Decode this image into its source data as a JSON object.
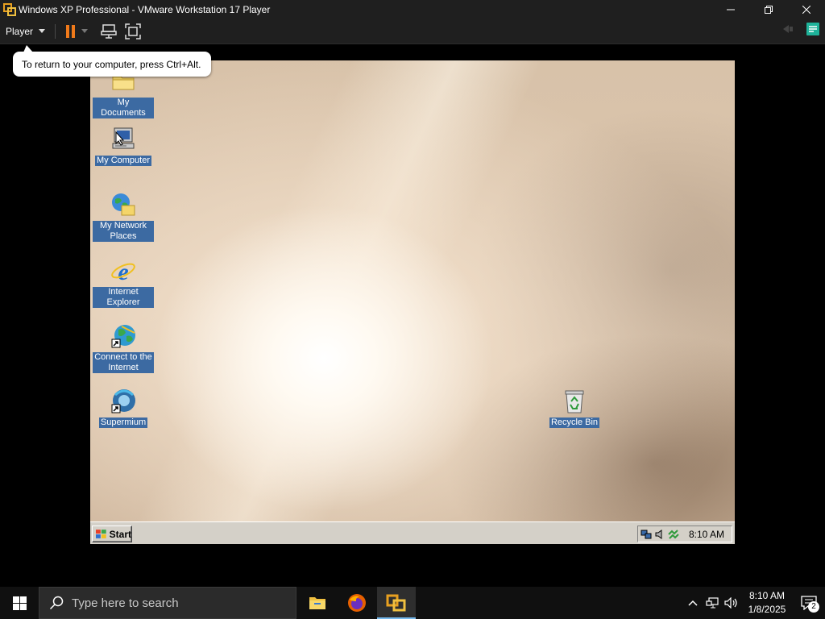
{
  "window": {
    "title": "Windows XP Professional - VMware Workstation 17 Player",
    "minimize_glyph": "—",
    "maximize_glyph": "❐",
    "close_glyph": "✕"
  },
  "toolbar": {
    "player_menu_label": "Player",
    "accent_color": "#f07a1a"
  },
  "tooltip": {
    "text": "To return to your computer, press Ctrl+Alt."
  },
  "guest": {
    "desktop_icons": [
      {
        "label": "My Documents",
        "icon": "folder-icon"
      },
      {
        "label": "My Computer",
        "icon": "computer-icon"
      },
      {
        "label": "My Network Places",
        "icon": "network-places-icon"
      },
      {
        "label": "Internet Explorer",
        "icon": "internet-explorer-icon"
      },
      {
        "label": "Connect to the Internet",
        "icon": "connect-internet-icon"
      },
      {
        "label": "Supermium",
        "icon": "supermium-icon"
      },
      {
        "label": "Recycle Bin",
        "icon": "recycle-bin-icon"
      }
    ],
    "taskbar": {
      "start_label": "Start",
      "clock": "8:10 AM"
    }
  },
  "host_taskbar": {
    "search_placeholder": "Type here to search",
    "time": "8:10 AM",
    "date": "1/8/2025",
    "notification_count": "2"
  }
}
